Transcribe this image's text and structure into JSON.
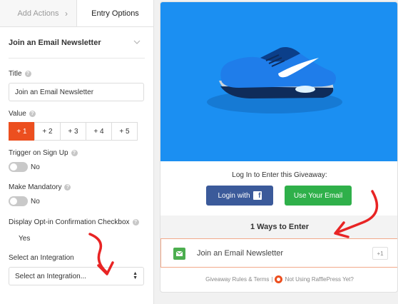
{
  "tabs": {
    "add_actions": "Add Actions",
    "entry_options": "Entry Options"
  },
  "section": {
    "title": "Join an Email Newsletter"
  },
  "title_field": {
    "label": "Title",
    "value": "Join an Email Newsletter"
  },
  "value_field": {
    "label": "Value",
    "options": [
      "+ 1",
      "+ 2",
      "+ 3",
      "+ 4",
      "+ 5"
    ],
    "selected": "+ 1"
  },
  "trigger_on_signup": {
    "label": "Trigger on Sign Up",
    "state": "No"
  },
  "make_mandatory": {
    "label": "Make Mandatory",
    "state": "No"
  },
  "optin_checkbox": {
    "label": "Display Opt-in Confirmation Checkbox",
    "option": "Yes"
  },
  "integration": {
    "label": "Select an Integration",
    "value": "Select an Integration..."
  },
  "preview": {
    "login_prompt": "Log In to Enter this Giveaway:",
    "login_fb": "Login with",
    "use_email": "Use Your Email",
    "ways_title": "1 Ways to Enter",
    "entry_label": "Join an Email Newsletter",
    "entry_points": "+1",
    "footer_rules": "Giveaway Rules & Terms",
    "footer_sep": "|",
    "footer_cta": "Not Using RafflePress Yet?"
  },
  "colors": {
    "accent": "#ec4f1f",
    "hero_bg": "#1b8ff2",
    "facebook": "#3b5a9a",
    "email_green": "#2fb04a",
    "annotation_red": "#e82424"
  }
}
